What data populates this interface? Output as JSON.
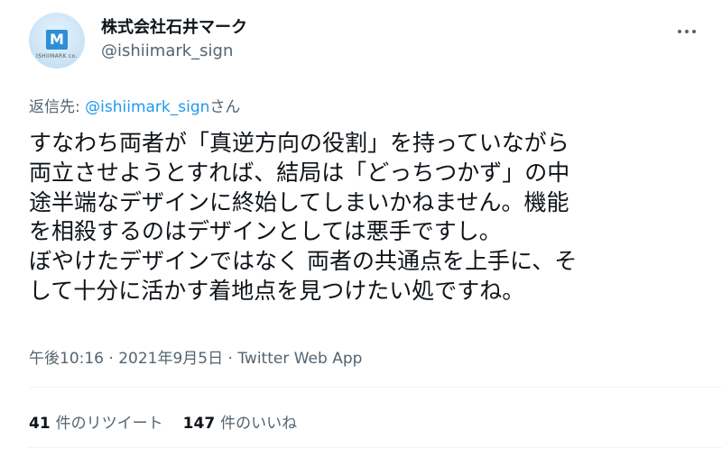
{
  "author": {
    "display_name": "株式会社石井マーク",
    "handle": "@ishiimark_sign",
    "avatar_logo_letter": "M",
    "avatar_text": "ISHIIMARK co."
  },
  "reply": {
    "prefix": "返信先: ",
    "mention": "@ishiimark_sign",
    "suffix": "さん"
  },
  "tweet": {
    "lines": [
      "すなわち両者が「真逆方向の役割」を持っていながら",
      "両立させようとすれば、結局は「どっちつかず」の中",
      "途半端なデザインに終始してしまいかねません。機能",
      "を相殺するのはデザインとしては悪手ですし。",
      "ぼやけたデザインではなく 両者の共通点を上手に、そ",
      "して十分に活かす着地点を見つけたい処ですね。"
    ]
  },
  "meta": {
    "time": "午後10:16",
    "separator": " · ",
    "date": "2021年9月5日",
    "source": "Twitter Web App"
  },
  "stats": {
    "retweets_count": "41",
    "retweets_label": "件のリツイート",
    "likes_count": "147",
    "likes_label": "件のいいね"
  },
  "icons": {
    "more": "more-horizontal-icon"
  },
  "colors": {
    "text": "#0f1419",
    "secondary": "#536471",
    "link": "#1d9bf0",
    "divider": "#eff3f4"
  }
}
